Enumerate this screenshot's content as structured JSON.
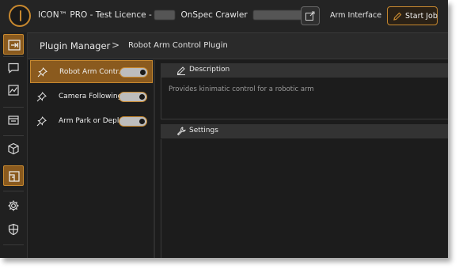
{
  "header": {
    "title_prefix": "ICON™  PRO - Test Licence - ",
    "title_middle": "OnSpec Crawler",
    "arm_interface_label": "Arm Interface",
    "start_job_label": "Start Job"
  },
  "sidebar": {
    "items": [
      {
        "icon": "import-icon",
        "active": true
      },
      {
        "icon": "chat-icon",
        "active": false
      },
      {
        "icon": "chart-icon",
        "active": false
      },
      {
        "icon": "archive-icon",
        "active": false
      },
      {
        "icon": "cube-icon",
        "active": false
      },
      {
        "icon": "plugin-manager-icon",
        "active": true
      },
      {
        "icon": "gear-icon",
        "active": false
      },
      {
        "icon": "shield-icon",
        "active": false
      }
    ]
  },
  "breadcrumb": {
    "root": "Plugin Manager",
    "separator": ">",
    "current": "Robot Arm Control Plugin"
  },
  "plugins": [
    {
      "name": "Robot Arm Contr...",
      "enabled": true,
      "selected": true
    },
    {
      "name": "Camera Following",
      "enabled": true,
      "selected": false
    },
    {
      "name": "Arm Park or Depl...",
      "enabled": true,
      "selected": false
    }
  ],
  "description": {
    "title": "Description",
    "text": "Provides kinimatic control for a robotic arm"
  },
  "settings": {
    "title": "Settings"
  },
  "colors": {
    "accent": "#c8892f",
    "selected_bg": "#8a5a1e",
    "background": "#1c1c1c"
  }
}
